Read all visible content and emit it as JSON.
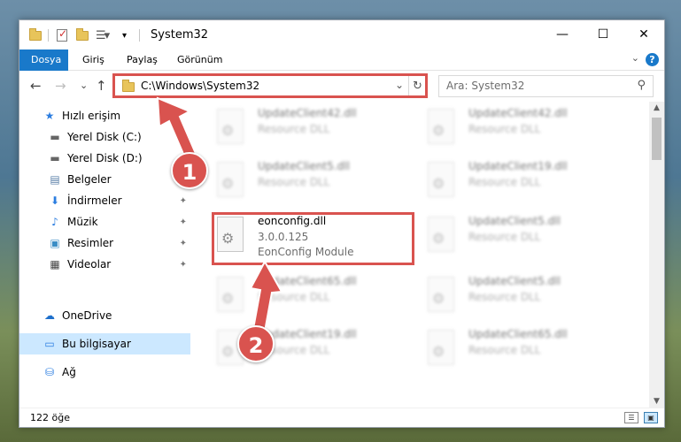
{
  "window": {
    "title": "System32",
    "controls": {
      "minimize": "—",
      "maximize": "☐",
      "close": "✕"
    }
  },
  "ribbon": {
    "tabs": [
      "Dosya",
      "Giriş",
      "Paylaş",
      "Görünüm"
    ],
    "help": "?",
    "chevron": "⌄"
  },
  "navigation": {
    "back": "←",
    "forward": "→",
    "recent": "⌄",
    "up": "↑",
    "address": "C:\\Windows\\System32",
    "address_dropdown": "⌄",
    "refresh": "↻",
    "search_placeholder": "Ara: System32",
    "search_icon": "⚲"
  },
  "sidebar": {
    "items": [
      {
        "label": "Hızlı erişim",
        "icon": "star-icon",
        "glyph": "★",
        "pinned": false
      },
      {
        "label": "Yerel Disk (C:)",
        "icon": "drive-icon",
        "glyph": "▬",
        "pinned": true
      },
      {
        "label": "Yerel Disk (D:)",
        "icon": "drive-icon",
        "glyph": "▬",
        "pinned": true
      },
      {
        "label": "Belgeler",
        "icon": "documents-icon",
        "glyph": "▤",
        "pinned": true
      },
      {
        "label": "İndirmeler",
        "icon": "downloads-icon",
        "glyph": "⬇",
        "pinned": true
      },
      {
        "label": "Müzik",
        "icon": "music-icon",
        "glyph": "♪",
        "pinned": true
      },
      {
        "label": "Resimler",
        "icon": "pictures-icon",
        "glyph": "▣",
        "pinned": true
      },
      {
        "label": "Videolar",
        "icon": "videos-icon",
        "glyph": "▦",
        "pinned": true
      },
      {
        "label": "OneDrive",
        "icon": "onedrive-icon",
        "glyph": "☁",
        "pinned": false
      },
      {
        "label": "Bu bilgisayar",
        "icon": "this-pc-icon",
        "glyph": "▭",
        "pinned": false
      },
      {
        "label": "Ağ",
        "icon": "network-icon",
        "glyph": "⛁",
        "pinned": false
      }
    ],
    "pin_glyph": "📌"
  },
  "files": {
    "left_column": [
      {
        "name": "UpdateClient42.dll",
        "line2": "Resource DLL",
        "line3": ""
      },
      {
        "name": "UpdateClient5.dll",
        "line2": "Resource DLL",
        "line3": ""
      },
      {
        "name": "eonconfig.dll",
        "line2": "3.0.0.125",
        "line3": "EonConfig Module"
      },
      {
        "name": "UpdateClient65.dll",
        "line2": "Resource DLL",
        "line3": ""
      },
      {
        "name": "UpdateClient19.dll",
        "line2": "Resource DLL",
        "line3": ""
      }
    ],
    "right_column": [
      {
        "name": "UpdateClient42.dll",
        "line2": "Resource DLL"
      },
      {
        "name": "UpdateClient19.dll",
        "line2": "Resource DLL"
      },
      {
        "name": "UpdateClient5.dll",
        "line2": "Resource DLL"
      },
      {
        "name": "UpdateClient5.dll",
        "line2": "Resource DLL"
      },
      {
        "name": "UpdateClient65.dll",
        "line2": "Resource DLL"
      }
    ]
  },
  "status": {
    "item_count": "122 öğe"
  },
  "annotations": {
    "step1": "1",
    "step2": "2",
    "color": "#d9534f"
  }
}
